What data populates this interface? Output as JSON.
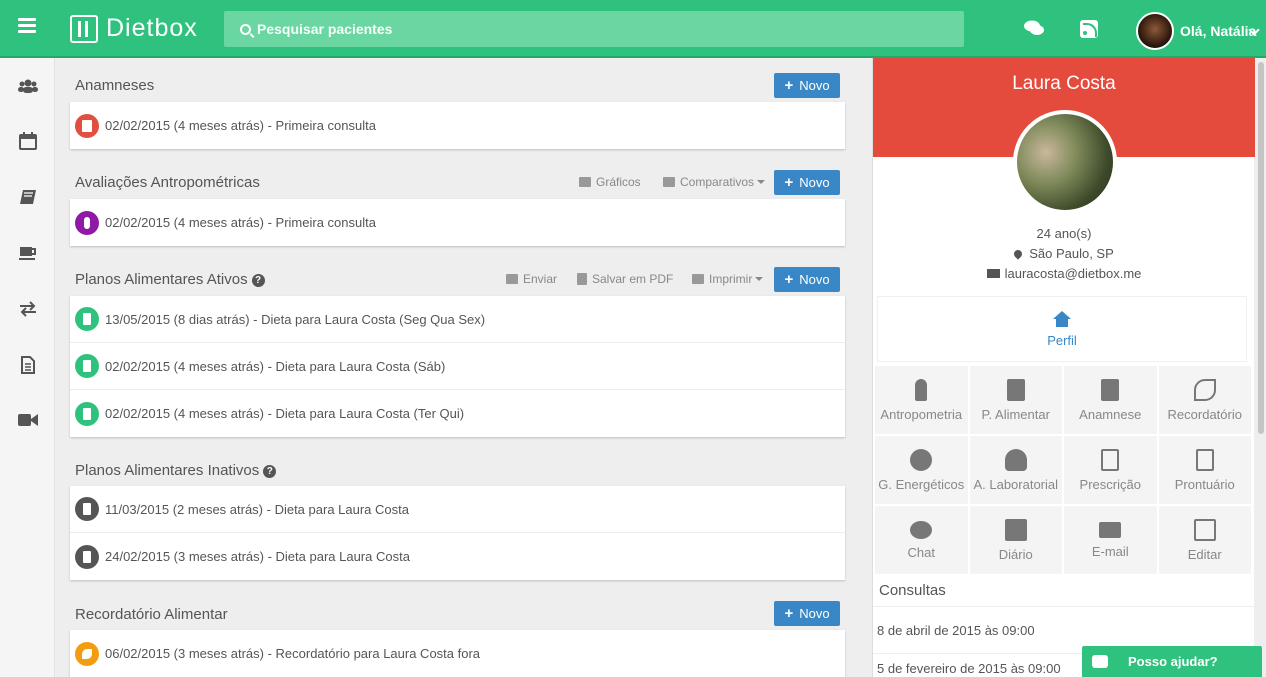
{
  "app": {
    "brand": "Dietbox"
  },
  "search": {
    "label": "Pesquisar pacientes"
  },
  "user": {
    "greeting": "Olá, Natália"
  },
  "sections": {
    "anamneses": {
      "title": "Anamneses",
      "new_label": "Novo",
      "rows": [
        "02/02/2015 (4 meses atrás) - Primeira consulta"
      ]
    },
    "avaliacoes": {
      "title": "Avaliações Antropométricas",
      "tools": {
        "graficos": "Gráficos",
        "comparativos": "Comparativos"
      },
      "new_label": "Novo",
      "rows": [
        "02/02/2015 (4 meses atrás) - Primeira consulta"
      ]
    },
    "planos_ativos": {
      "title": "Planos Alimentares Ativos",
      "tools": {
        "enviar": "Enviar",
        "pdf": "Salvar em PDF",
        "imprimir": "Imprimir"
      },
      "new_label": "Novo",
      "rows": [
        "13/05/2015 (8 dias atrás) - Dieta para Laura Costa (Seg Qua Sex)",
        "02/02/2015 (4 meses atrás) - Dieta para Laura Costa (Sáb)",
        "02/02/2015 (4 meses atrás) - Dieta para Laura Costa (Ter Qui)"
      ]
    },
    "planos_inativos": {
      "title": "Planos Alimentares Inativos",
      "rows": [
        "11/03/2015 (2 meses atrás) - Dieta para Laura Costa",
        "24/02/2015 (3 meses atrás) - Dieta para Laura Costa"
      ]
    },
    "recordatorio": {
      "title": "Recordatório Alimentar",
      "new_label": "Novo",
      "rows": [
        "06/02/2015 (3 meses atrás) - Recordatório para Laura Costa fora"
      ]
    }
  },
  "patient": {
    "name": "Laura Costa",
    "age": "24 ano(s)",
    "city": "São Paulo, SP",
    "email": "lauracosta@dietbox.me",
    "perfil": "Perfil",
    "menu": [
      "Antropometria",
      "P. Alimentar",
      "Anamnese",
      "Recordatório",
      "G. Energéticos",
      "A. Laboratorial",
      "Prescrição",
      "Prontuário",
      "Chat",
      "Diário",
      "E-mail",
      "Editar"
    ],
    "consultas_title": "Consultas",
    "consultas": [
      "8 de abril de 2015 às 09:00",
      "5 de fevereiro de 2015 às 09:00"
    ]
  },
  "help_button": "Posso ajudar?",
  "colors": {
    "brand_green": "#2ec27e",
    "header_red": "#e54b3c",
    "button_blue": "#3a87c8"
  }
}
